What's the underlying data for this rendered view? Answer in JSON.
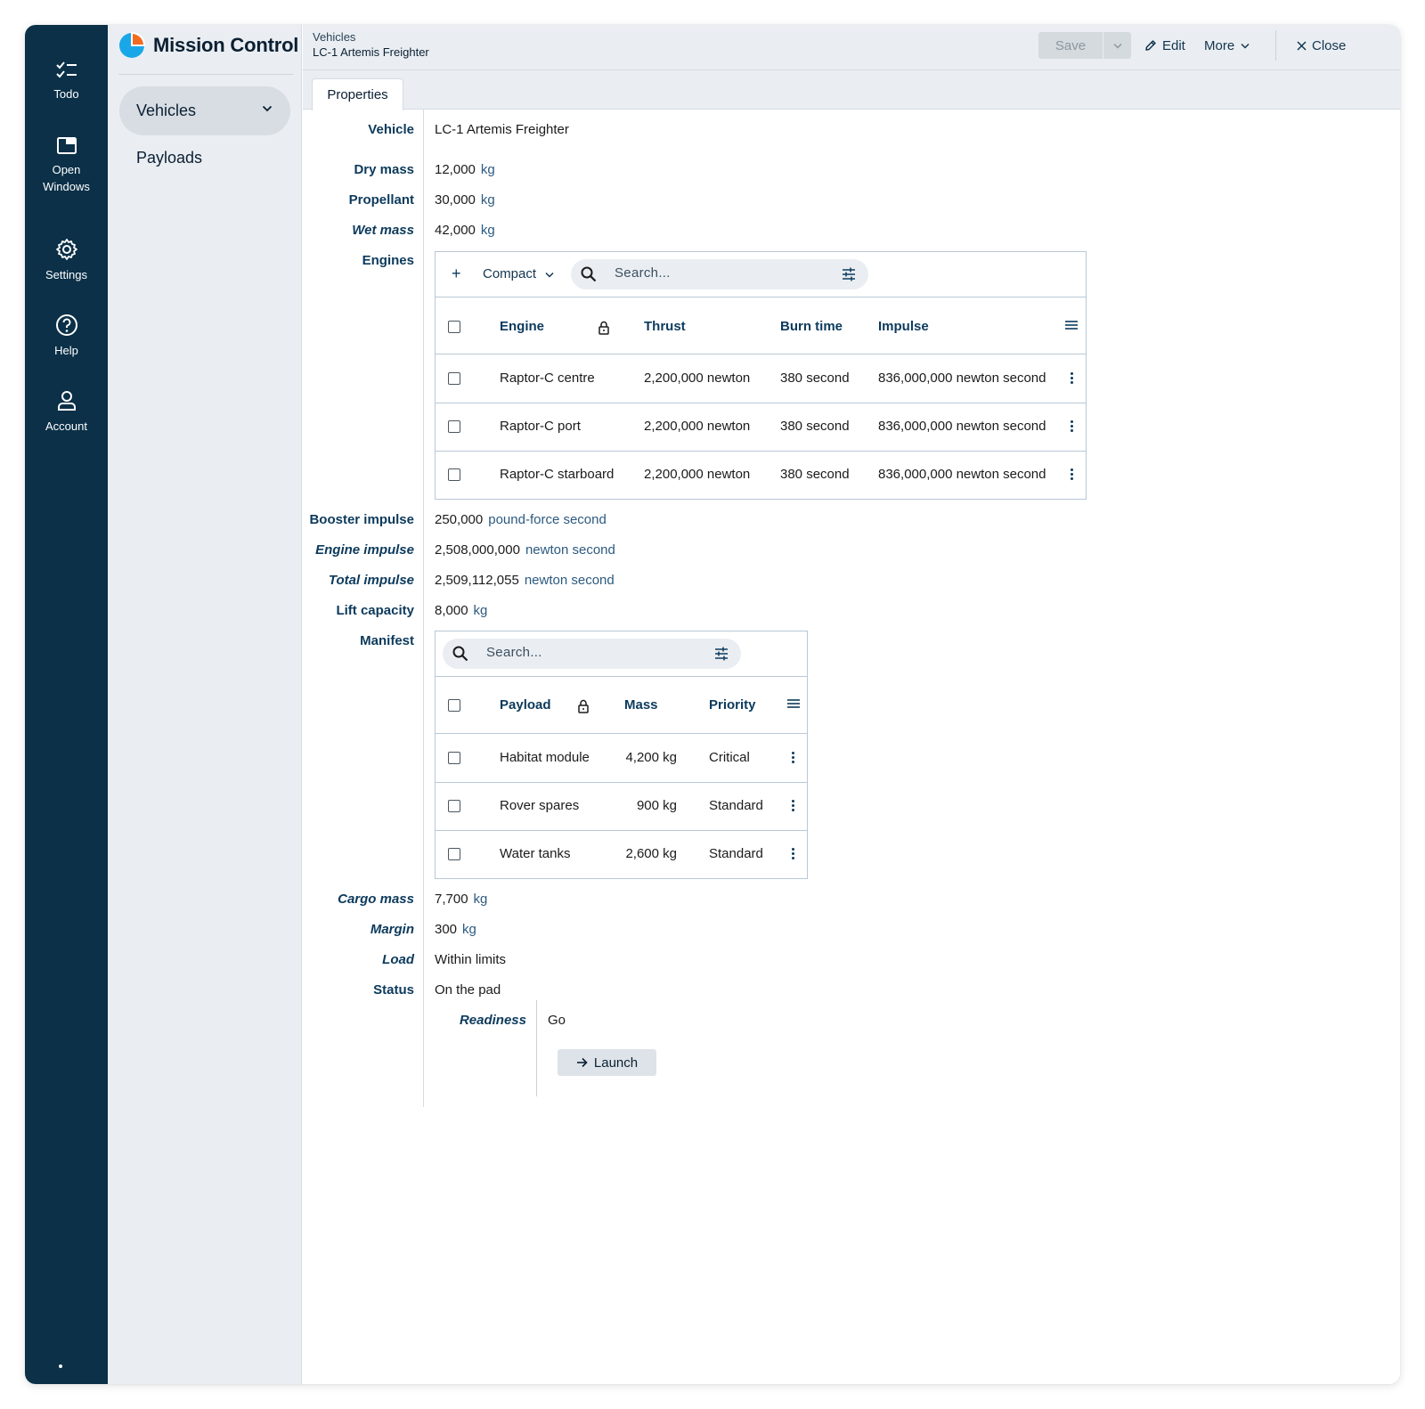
{
  "rail": {
    "items": [
      {
        "label": "Todo",
        "icon": "checklist-icon"
      },
      {
        "label": "Open Windows",
        "icon": "window-icon"
      },
      {
        "label": "Settings",
        "icon": "gear-icon"
      },
      {
        "label": "Help",
        "icon": "help-circle-icon"
      },
      {
        "label": "Account",
        "icon": "user-icon"
      }
    ],
    "color": "#0b3048"
  },
  "nav": {
    "brand": "Mission Control",
    "items": [
      {
        "label": "Vehicles",
        "selected": true
      },
      {
        "label": "Payloads",
        "selected": false
      }
    ]
  },
  "header": {
    "breadcrumb": "Vehicles",
    "title": "LC-1 Artemis Freighter",
    "save_label": "Save",
    "edit_label": "Edit",
    "more_label": "More",
    "close_label": "Close"
  },
  "tabs": [
    {
      "label": "Properties",
      "active": true
    }
  ],
  "fields": {
    "vehicle": {
      "label": "Vehicle",
      "value": "LC-1 Artemis Freighter"
    },
    "dry_mass": {
      "label": "Dry mass",
      "value": "12,000",
      "unit": "kg"
    },
    "propellant": {
      "label": "Propellant",
      "value": "30,000",
      "unit": "kg"
    },
    "wet_mass": {
      "label": "Wet mass",
      "value": "42,000",
      "unit": "kg"
    },
    "engines": {
      "label": "Engines"
    },
    "booster_impulse": {
      "label": "Booster impulse",
      "value": "250,000",
      "unit": "pound-force second"
    },
    "engine_impulse": {
      "label": "Engine impulse",
      "value": "2,508,000,000",
      "unit": "newton second"
    },
    "total_impulse": {
      "label": "Total impulse",
      "value": "2,509,112,055",
      "unit": "newton second"
    },
    "lift_capacity": {
      "label": "Lift capacity",
      "value": "8,000",
      "unit": "kg"
    },
    "manifest": {
      "label": "Manifest"
    },
    "cargo_mass": {
      "label": "Cargo mass",
      "value": "7,700",
      "unit": "kg"
    },
    "margin": {
      "label": "Margin",
      "value": "300",
      "unit": "kg"
    },
    "load": {
      "label": "Load",
      "value": "Within limits"
    },
    "status": {
      "label": "Status",
      "value": "On the pad"
    },
    "readiness": {
      "label": "Readiness",
      "value": "Go"
    }
  },
  "engines_table": {
    "add_label": "+",
    "density_label": "Compact",
    "search_placeholder": "Search...",
    "columns": [
      "Engine",
      "Thrust",
      "Burn time",
      "Impulse"
    ],
    "rows": [
      {
        "engine": "Raptor-C centre",
        "thrust": "2,200,000 newton",
        "burn": "380 second",
        "impulse": "836,000,000 newton second"
      },
      {
        "engine": "Raptor-C port",
        "thrust": "2,200,000 newton",
        "burn": "380 second",
        "impulse": "836,000,000 newton second"
      },
      {
        "engine": "Raptor-C starboard",
        "thrust": "2,200,000 newton",
        "burn": "380 second",
        "impulse": "836,000,000 newton second"
      }
    ]
  },
  "manifest_table": {
    "search_placeholder": "Search...",
    "columns": [
      "Payload",
      "Mass",
      "Priority"
    ],
    "rows": [
      {
        "payload": "Habitat module",
        "mass": "4,200 kg",
        "priority": "Critical"
      },
      {
        "payload": "Rover spares",
        "mass": "900 kg",
        "priority": "Standard"
      },
      {
        "payload": "Water tanks",
        "mass": "2,600 kg",
        "priority": "Standard"
      }
    ]
  },
  "actions": {
    "launch_label": "Launch"
  },
  "colors": {
    "accent": "#0c3a5c",
    "unit": "#2c5a80",
    "logo_blue": "#1aa7e8",
    "logo_orange": "#f26b21"
  }
}
